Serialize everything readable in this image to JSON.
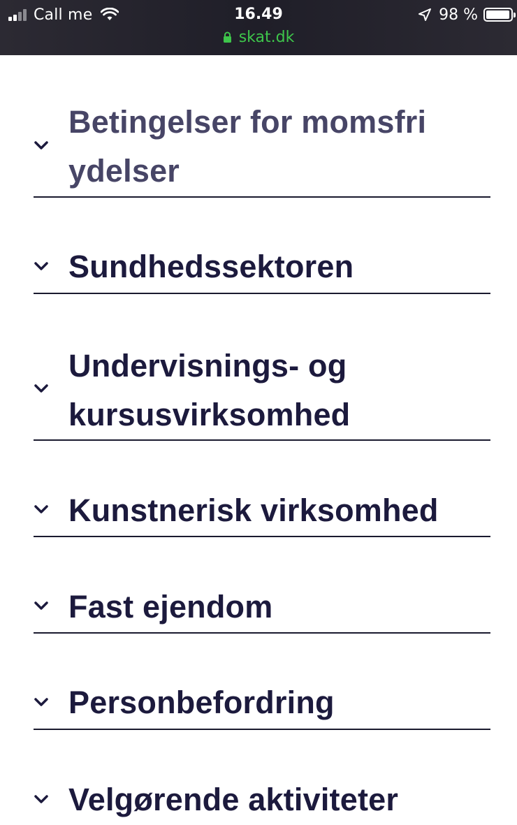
{
  "status_bar": {
    "carrier": "Call me",
    "time": "16.49",
    "url": "skat.dk",
    "battery": "98 %",
    "battery_level": 0.98,
    "signal_icon": "signal-icon",
    "wifi_icon": "wifi-icon",
    "lock_icon": "lock-icon",
    "location_icon": "location-arrow-icon"
  },
  "accordion": {
    "items": [
      {
        "label": "Betingelser for momsfri ydelser",
        "icon": "chevron-down-icon"
      },
      {
        "label": "Sundhedssektoren",
        "icon": "chevron-down-icon"
      },
      {
        "label": "Undervisnings- og kursusvirksomhed",
        "icon": "chevron-down-icon"
      },
      {
        "label": "Kunstnerisk virksomhed",
        "icon": "chevron-down-icon"
      },
      {
        "label": "Fast ejendom",
        "icon": "chevron-down-icon"
      },
      {
        "label": "Personbefordring",
        "icon": "chevron-down-icon"
      },
      {
        "label": "Velgørende aktiviteter",
        "icon": "chevron-down-icon"
      }
    ]
  },
  "colors": {
    "heading": "#1c1a3d",
    "heading_muted": "#474566",
    "divider": "#1a1a2e",
    "url_green": "#3ec54b",
    "status_bg": "#1f1e28"
  }
}
